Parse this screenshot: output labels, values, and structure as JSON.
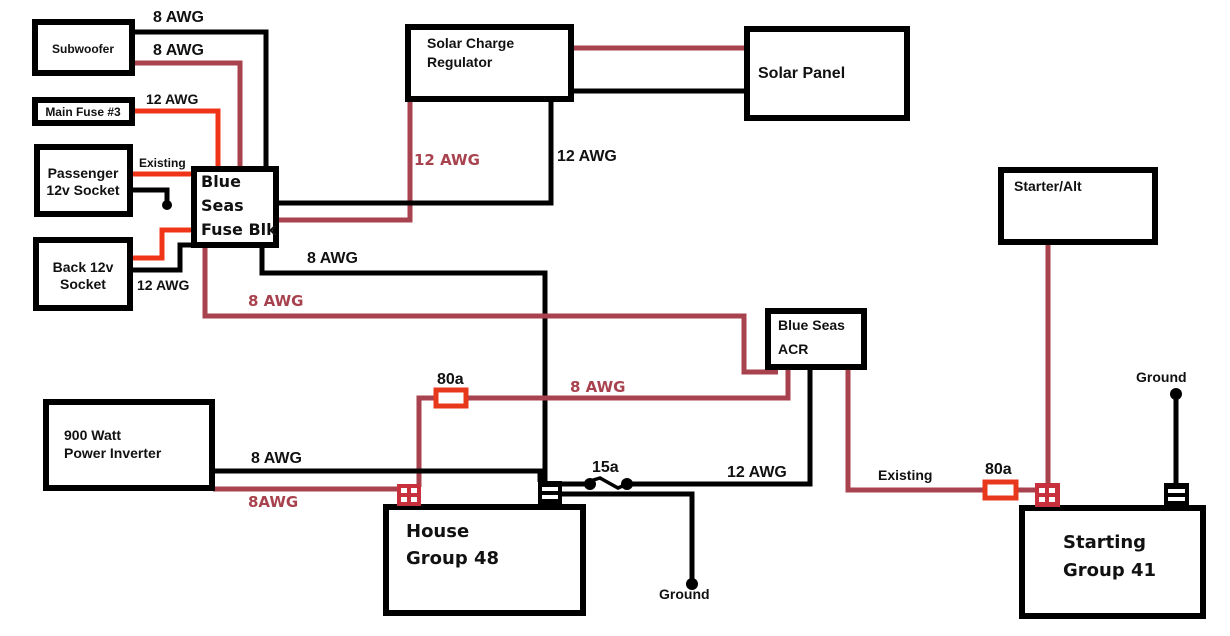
{
  "diagram": {
    "colors": {
      "negative_wire": "#000000",
      "positive_wire": "#a8424e",
      "existing_positive_wire": "#f03418",
      "fuse_outline": "#e8381c"
    },
    "components": {
      "subwoofer": "Subwoofer",
      "main_fuse": "Main Fuse #3",
      "passenger_socket_line1": "Passenger",
      "passenger_socket_line2": "12v Socket",
      "back_socket_line1": "Back 12v",
      "back_socket_line2": "Socket",
      "fuse_block_line1": "Blue",
      "fuse_block_line2": "Seas",
      "fuse_block_line3": "Fuse Blk",
      "solar_regulator_line1": "Solar Charge",
      "solar_regulator_line2": "Regulator",
      "solar_panel": "Solar Panel",
      "starter_alt": "Starter/Alt",
      "acr_line1": "Blue Seas",
      "acr_line2": "ACR",
      "inverter_line1": "900 Watt",
      "inverter_line2": "Power Inverter",
      "house_battery_line1": "House",
      "house_battery_line2": "Group  48",
      "starting_battery_line1": "Starting",
      "starting_battery_line2": "Group 41"
    },
    "wire_labels": {
      "sub_neg": "8 AWG",
      "sub_pos": "8 AWG",
      "main_fuse": "12 AWG",
      "passenger_existing": "Existing",
      "back_socket": "12 AWG",
      "regulator_pos": "12 AWG",
      "regulator_neg": "12 AWG",
      "fuse_blk_neg": "8 AWG",
      "fuse_blk_pos": "8 AWG",
      "acr_to_house": "8 AWG",
      "inverter_neg": "8 AWG",
      "inverter_pos": "8AWG",
      "acr_neg": "12 AWG",
      "acr_to_start_existing": "Existing"
    },
    "fuses": {
      "house_fuse": "80a",
      "start_fuse": "80a",
      "ground_fuse": "15a"
    },
    "grounds": {
      "house_ground": "Ground",
      "start_ground": "Ground"
    }
  }
}
